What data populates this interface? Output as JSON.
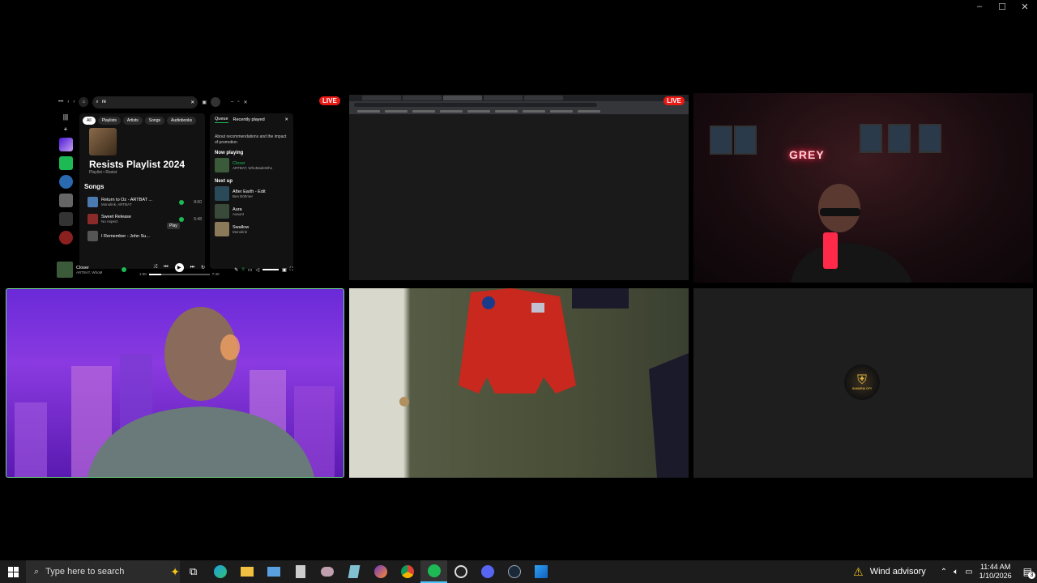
{
  "window": {
    "minimize": "–",
    "maximize": "☐",
    "close": "✕"
  },
  "live_label": "LIVE",
  "spotify": {
    "search_value": "re",
    "chips": [
      "All",
      "Playlists",
      "Artists",
      "Songs",
      "Audiobooks"
    ],
    "playlist_title": "Resists Playlist 2024",
    "playlist_sub": "Playlist • Resist",
    "songs_heading": "Songs",
    "songs": [
      {
        "title": "Return to Oz - ARTBAT ...",
        "artist": "Monolink, ARTBAT",
        "duration": "8:00",
        "color": "#4a7ab0"
      },
      {
        "title": "Sweet Release",
        "artist": "No Aspect",
        "duration": "5:48",
        "color": "#8a2a2a"
      },
      {
        "title": "I Remember - John Su...",
        "artist": "",
        "duration": "",
        "color": "#555"
      }
    ],
    "tooltip_play": "Play",
    "queue": {
      "tab_queue": "Queue",
      "tab_recent": "Recently played",
      "note": "About recommendations and the impact of promotion",
      "now_playing_label": "Now playing",
      "now_playing": {
        "title": "Closer",
        "artist": "ARTBAT, WhoMadeWho"
      },
      "next_up_label": "Next up",
      "next": [
        {
          "title": "After Earth - Edit",
          "artist": "Ben Böhmer"
        },
        {
          "title": "Aura",
          "artist": "Avaunt"
        },
        {
          "title": "Swallow",
          "artist": "Monolink"
        }
      ]
    },
    "player": {
      "title": "Closer",
      "artist": "ARTBAT, WhoM",
      "elapsed": "1:00",
      "total": "7:40",
      "progress": 0.2
    }
  },
  "webcam_sign": "GREY",
  "logo_text": "SAMURAI CFY",
  "taskbar": {
    "search_placeholder": "Type here to search",
    "weather": "Wind advisory",
    "time": "11:44 AM",
    "date": "1/10/2026",
    "notif_count": "3"
  }
}
